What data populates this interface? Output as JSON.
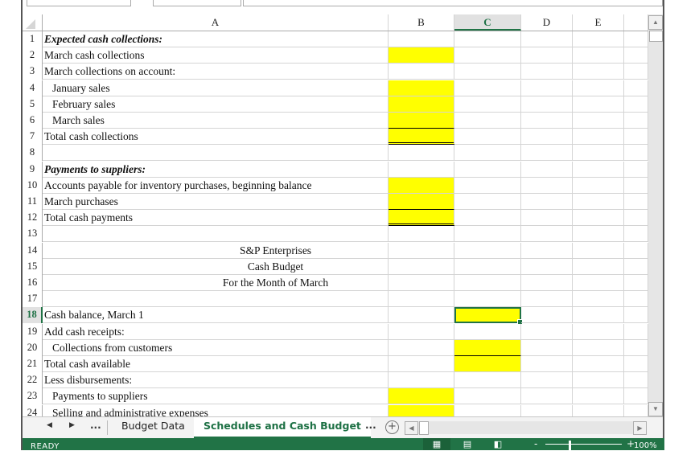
{
  "columns": {
    "A": "A",
    "B": "B",
    "C": "C",
    "D": "D",
    "E": "E",
    "F": ""
  },
  "selected_cell": "C18",
  "rows": [
    {
      "n": "1",
      "a": "Expected cash collections:",
      "style": "bi"
    },
    {
      "n": "2",
      "a": "March cash collections"
    },
    {
      "n": "3",
      "a": "March collections on account:"
    },
    {
      "n": "4",
      "a": "January sales",
      "indent": true
    },
    {
      "n": "5",
      "a": "February sales",
      "indent": true
    },
    {
      "n": "6",
      "a": "March sales",
      "indent": true
    },
    {
      "n": "7",
      "a": "Total cash collections"
    },
    {
      "n": "8",
      "a": ""
    },
    {
      "n": "9",
      "a": "Payments to suppliers:",
      "style": "bi"
    },
    {
      "n": "10",
      "a": "Accounts payable for inventory purchases, beginning balance"
    },
    {
      "n": "11",
      "a": "March purchases"
    },
    {
      "n": "12",
      "a": "Total cash payments"
    },
    {
      "n": "13",
      "a": ""
    },
    {
      "n": "14",
      "a": "S&P Enterprises",
      "center": true
    },
    {
      "n": "15",
      "a": "Cash Budget",
      "center": true
    },
    {
      "n": "16",
      "a": "For the Month of March",
      "center": true
    },
    {
      "n": "17",
      "a": ""
    },
    {
      "n": "18",
      "a": "Cash balance, March 1"
    },
    {
      "n": "19",
      "a": "Add cash receipts:"
    },
    {
      "n": "20",
      "a": "Collections from customers",
      "indent": true
    },
    {
      "n": "21",
      "a": "Total cash available"
    },
    {
      "n": "22",
      "a": "Less disbursements:"
    },
    {
      "n": "23",
      "a": "Payments to suppliers",
      "indent": true
    },
    {
      "n": "24",
      "a": "Selling and administrative expenses",
      "indent": true
    }
  ],
  "input_cells": {
    "B": [
      2,
      4,
      5,
      6,
      7,
      10,
      11,
      12,
      23,
      24
    ],
    "C": [
      18,
      20,
      21
    ]
  },
  "highlight_color": "#ffff00",
  "accent_color": "#217346",
  "sheet_tabs": {
    "prev": "◀",
    "next": "▶",
    "more": "...",
    "tabs": [
      {
        "label": "Budget Data",
        "active": false
      },
      {
        "label": "Schedules and Cash Budget",
        "active": true
      }
    ],
    "more_right": "...",
    "add": "+"
  },
  "status_bar": {
    "mode": "READY",
    "zoom": "100%",
    "zoom_minus": "-",
    "zoom_plus": "+"
  }
}
